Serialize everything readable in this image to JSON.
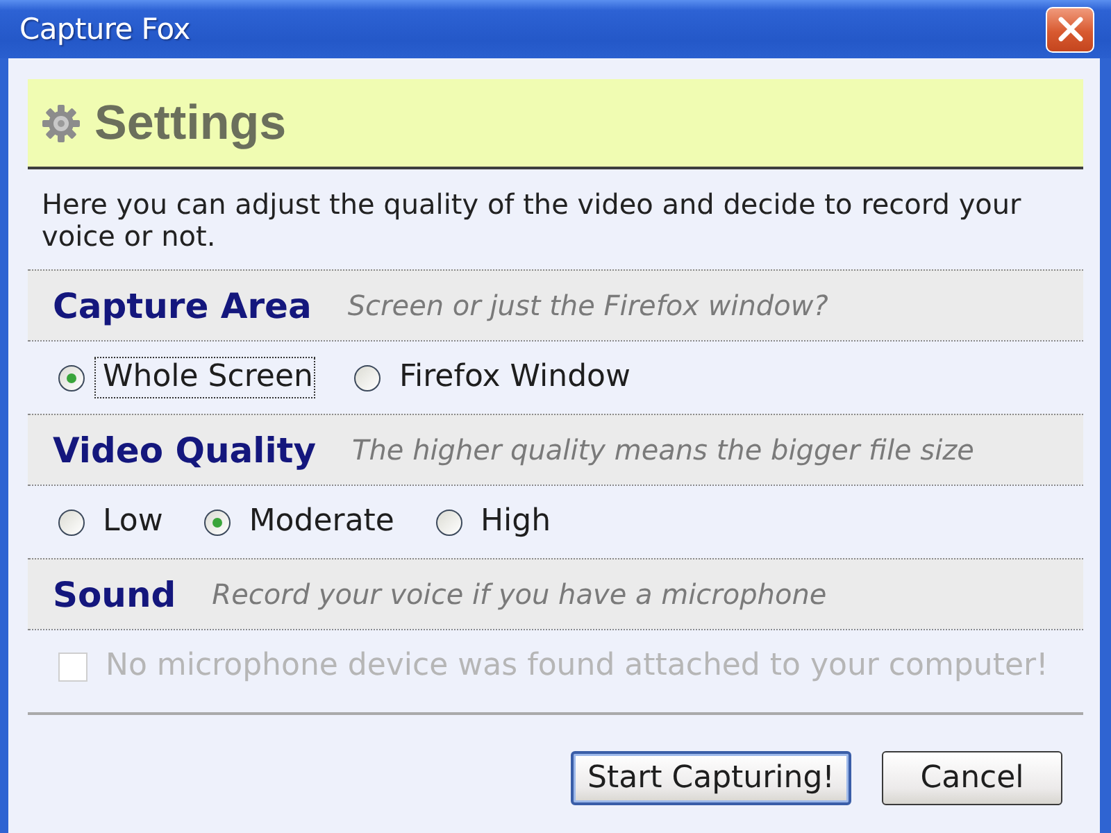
{
  "window": {
    "title": "Capture Fox"
  },
  "header": {
    "title": "Settings"
  },
  "description": "Here you can adjust the quality of the video and decide to record your voice or not.",
  "sections": [
    {
      "title": "Capture Area",
      "hint": "Screen or just the Firefox window?",
      "options": [
        {
          "kind": "radio",
          "label": "Whole Screen",
          "selected": true,
          "focused": true,
          "disabled": false
        },
        {
          "kind": "radio",
          "label": "Firefox Window",
          "selected": false,
          "focused": false,
          "disabled": false
        }
      ]
    },
    {
      "title": "Video Quality",
      "hint": "The higher quality means the bigger file size",
      "options": [
        {
          "kind": "radio",
          "label": "Low",
          "selected": false,
          "focused": false,
          "disabled": false
        },
        {
          "kind": "radio",
          "label": "Moderate",
          "selected": true,
          "focused": false,
          "disabled": false
        },
        {
          "kind": "radio",
          "label": "High",
          "selected": false,
          "focused": false,
          "disabled": false
        }
      ]
    },
    {
      "title": "Sound",
      "hint": "Record your voice if you have a microphone",
      "options": [
        {
          "kind": "checkbox",
          "label": "No microphone device was found attached to your computer!",
          "checked": false,
          "focused": false,
          "disabled": true
        }
      ]
    }
  ],
  "buttons": [
    {
      "label": "Start Capturing!",
      "default": true
    },
    {
      "label": "Cancel",
      "default": false
    }
  ]
}
